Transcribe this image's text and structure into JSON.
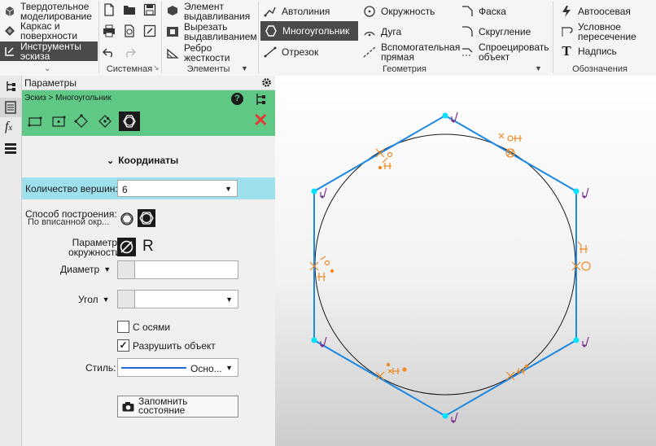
{
  "ribbon": {
    "mode_items": [
      {
        "label": "Твердотельное моделирование",
        "icon": "solid-modeling-icon"
      },
      {
        "label": "Каркас и поверхности",
        "icon": "wireframe-surfaces-icon"
      },
      {
        "label": "Инструменты эскиза",
        "icon": "sketch-tools-icon"
      }
    ],
    "system": {
      "title": "Системная",
      "buttons": [
        "new-document-icon",
        "open-icon",
        "save-icon",
        "print-icon",
        "preview-icon",
        "save-as-icon",
        "undo-icon",
        "redo-icon"
      ]
    },
    "elements": {
      "title": "Элементы",
      "items": [
        {
          "label": "Элемент выдавливания",
          "icon": "extrude-icon"
        },
        {
          "label": "Вырезать выдавливанием",
          "icon": "cut-extrude-icon"
        },
        {
          "label": "Ребро жесткости",
          "icon": "rib-icon"
        }
      ]
    },
    "geometry": {
      "title": "Геометрия",
      "items": [
        {
          "label": "Автолиния",
          "icon": "autoline-icon"
        },
        {
          "label": "Многоугольник",
          "icon": "polygon-icon"
        },
        {
          "label": "Отрезок",
          "icon": "segment-icon"
        },
        {
          "label": "Окружность",
          "icon": "circle-icon"
        },
        {
          "label": "Дуга",
          "icon": "arc-icon"
        },
        {
          "label": "Вспомогательная прямая",
          "icon": "aux-line-icon"
        },
        {
          "label": "Фаска",
          "icon": "chamfer-icon"
        },
        {
          "label": "Скругление",
          "icon": "fillet-icon"
        },
        {
          "label": "Спроецировать объект",
          "icon": "project-object-icon"
        }
      ]
    },
    "designations": {
      "title": "Обозначения",
      "items": [
        {
          "label": "Автоосевая",
          "icon": "auto-axis-icon"
        },
        {
          "label": "Условное пересечение",
          "icon": "conditional-intersection-icon"
        },
        {
          "label": "Надпись",
          "icon": "text-icon"
        }
      ]
    }
  },
  "panel": {
    "title": "Параметры",
    "breadcrumb": "Эскиз > Многоугольник",
    "section": "Координаты",
    "vertex_count_label": "Количество вершин:",
    "vertex_count_value": "6",
    "build_method_label": "Способ построения:",
    "build_method_value": "По вписанной окр...",
    "param_label": "Параметр окружности:",
    "param_r": "R",
    "diameter_label": "Диаметр",
    "angle_label": "Угол",
    "axes_label": "С осями",
    "axes_checked": false,
    "destroy_label": "Разрушить объект",
    "destroy_checked": true,
    "style_label": "Стиль:",
    "style_value": "Осно...",
    "remember_label": "Запомнить состояние"
  },
  "colors": {
    "panel_header": "#5ec884",
    "highlight_row": "#9fe0ef",
    "polygon": "#1e88e5",
    "vertex": "#00e5ff",
    "constraint": "#f08a24",
    "marker": "#7b2d8b"
  }
}
